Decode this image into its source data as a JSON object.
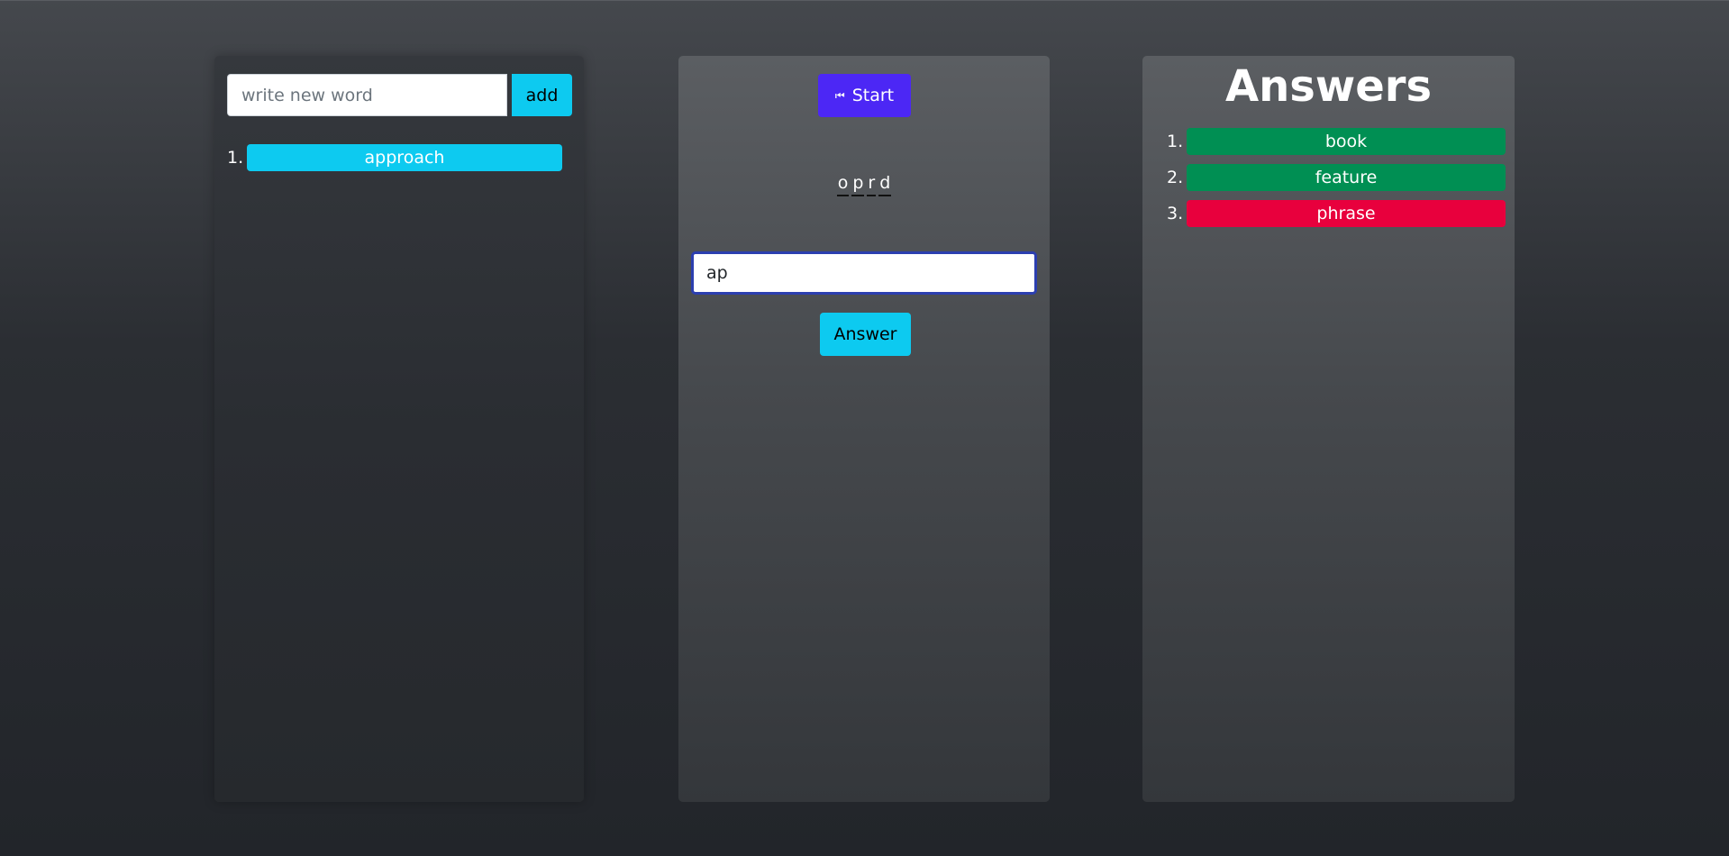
{
  "words_panel": {
    "input_placeholder": "write new word",
    "add_label": "add",
    "items": [
      {
        "num": "1.",
        "word": "approach",
        "color": "#0dcaf0"
      }
    ]
  },
  "game_panel": {
    "start_label": "Start",
    "start_icon": "skip-back-icon",
    "scrambled_letters": [
      "o",
      "p",
      "r",
      "d"
    ],
    "answer_value": "ap",
    "answer_label": "Answer"
  },
  "answers_panel": {
    "title": "Answers",
    "items": [
      {
        "num": "1.",
        "word": "book",
        "status": "correct",
        "color": "#008f53"
      },
      {
        "num": "2.",
        "word": "feature",
        "status": "correct",
        "color": "#008f53"
      },
      {
        "num": "3.",
        "word": "phrase",
        "status": "wrong",
        "color": "#e8003d"
      }
    ]
  },
  "colors": {
    "info": "#0dcaf0",
    "primary": "#4c27f5",
    "success": "#008f53",
    "danger": "#e8003d"
  }
}
